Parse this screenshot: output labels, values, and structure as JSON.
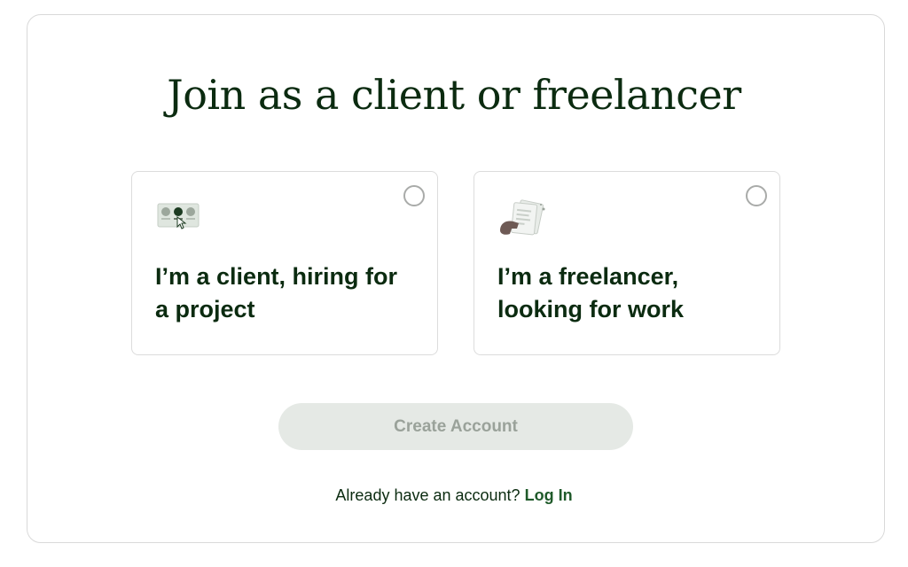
{
  "page": {
    "title": "Join as a client or freelancer"
  },
  "options": [
    {
      "label_line1": "I’m a client, hiring for",
      "label_line2": "a project",
      "icon": "hiring-illustration-icon",
      "selected": false
    },
    {
      "label_line1": "I’m a freelancer,",
      "label_line2": "looking for work",
      "icon": "freelancer-documents-icon",
      "selected": false
    }
  ],
  "cta": {
    "label": "Create Account",
    "disabled": true
  },
  "login": {
    "prompt": "Already have an account?",
    "link": "Log In"
  },
  "colors": {
    "heading": "#0b2b10",
    "cta_bg_disabled": "#e5e9e5",
    "cta_text_disabled": "#9aa29a",
    "link": "#1f5a2a",
    "border": "#dcdcdc"
  }
}
